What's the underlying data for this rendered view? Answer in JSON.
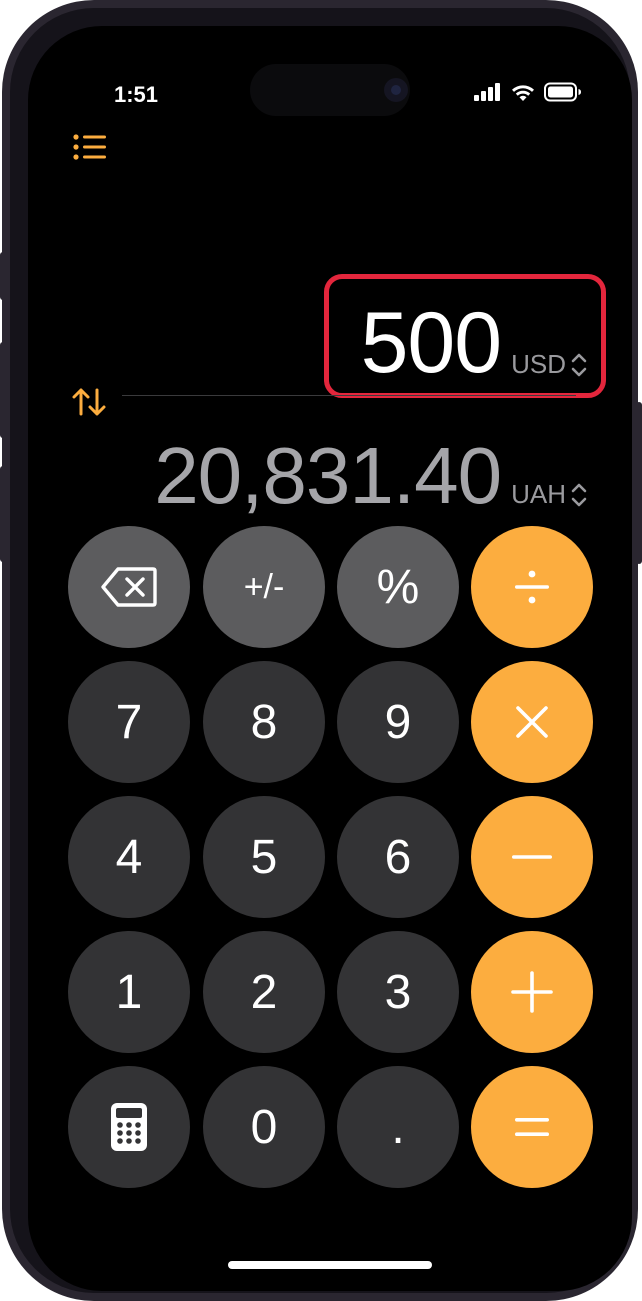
{
  "status_bar": {
    "time": "1:51"
  },
  "converter": {
    "primary": {
      "value": "500",
      "unit": "USD"
    },
    "secondary": {
      "value": "20,831.40",
      "unit": "UAH"
    }
  },
  "keypad": {
    "row1": [
      "+/-",
      "%"
    ],
    "digits": {
      "seven": "7",
      "eight": "8",
      "nine": "9",
      "four": "4",
      "five": "5",
      "six": "6",
      "one": "1",
      "two": "2",
      "three": "3",
      "zero": "0",
      "decimal": "."
    }
  },
  "colors": {
    "accent": "#fcad3f",
    "highlight": "#e3263c",
    "key_light": "#5c5c5e",
    "key_dark": "#333335"
  }
}
